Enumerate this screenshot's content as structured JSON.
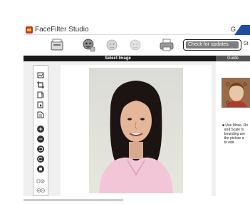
{
  "app": {
    "title": "FaceFilter Studio",
    "title_right_fragment": "G"
  },
  "toolbar": {
    "check_updates_label": "Check for updates",
    "right_fragment": "St",
    "icons": [
      "scanner-icon",
      "face-icon",
      "face-alt-icon",
      "face-disabled-icon",
      "printer-icon"
    ]
  },
  "band": {
    "title": "Select Image",
    "guide_tab": "Guide"
  },
  "guide": {
    "text": "■ Use Move, Ro\n  and Scale to\n  bounding are\n  the picture a\n  to edit."
  },
  "colors": {
    "accent_blue": "#1e4e9e",
    "band_black": "#1a1a1a",
    "button_gray": "#7d7d7d"
  }
}
